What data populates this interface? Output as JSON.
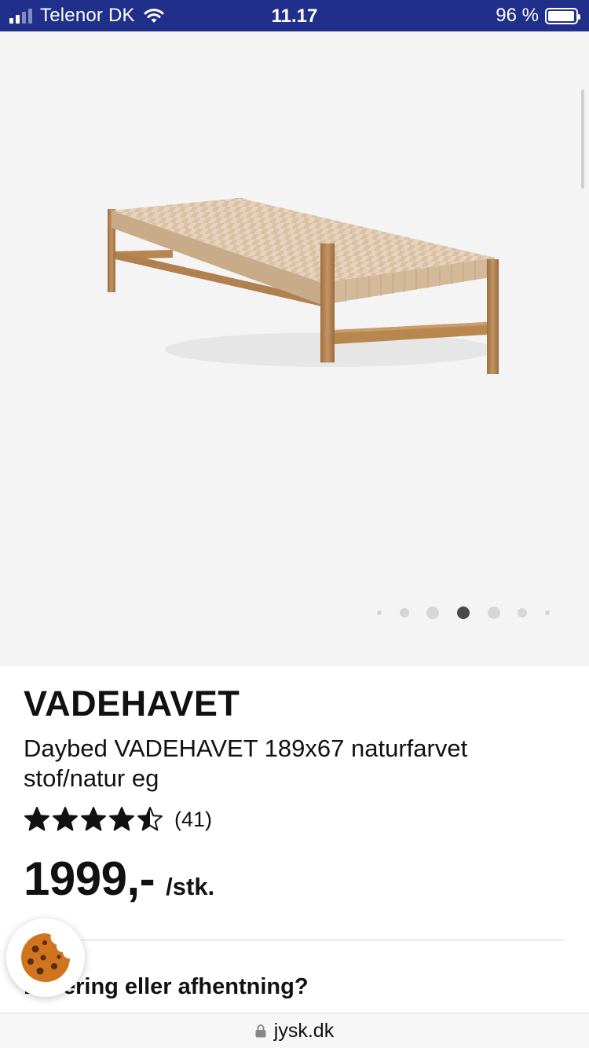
{
  "status_bar": {
    "carrier": "Telenor DK",
    "time": "11.17",
    "battery_percent": "96 %",
    "battery_level": 0.96,
    "icons": [
      "signal-icon",
      "wifi-icon",
      "battery-icon"
    ]
  },
  "gallery": {
    "image_icon": "daybed-image",
    "slide_count": 7,
    "active_slide_index": 3
  },
  "product": {
    "brand": "VADEHAVET",
    "description": "Daybed VADEHAVET 189x67 naturfarvet stof/natur eg",
    "rating_stars": 4.5,
    "rating_max": 5,
    "review_count": "(41)",
    "price": "1999,-",
    "unit": "/stk."
  },
  "delivery": {
    "heading": "Levering eller afhentning?"
  },
  "cookie_button": {
    "icon": "cookie-icon"
  },
  "url_bar": {
    "url": "jysk.dk",
    "icon": "lock-icon"
  },
  "colors": {
    "status_bar_bg": "#1f2f8a",
    "gallery_bg": "#f4f4f4",
    "active_dot": "#4a4a4a",
    "inactive_dot": "#d6d6d6",
    "cookie": "#d0741e"
  }
}
